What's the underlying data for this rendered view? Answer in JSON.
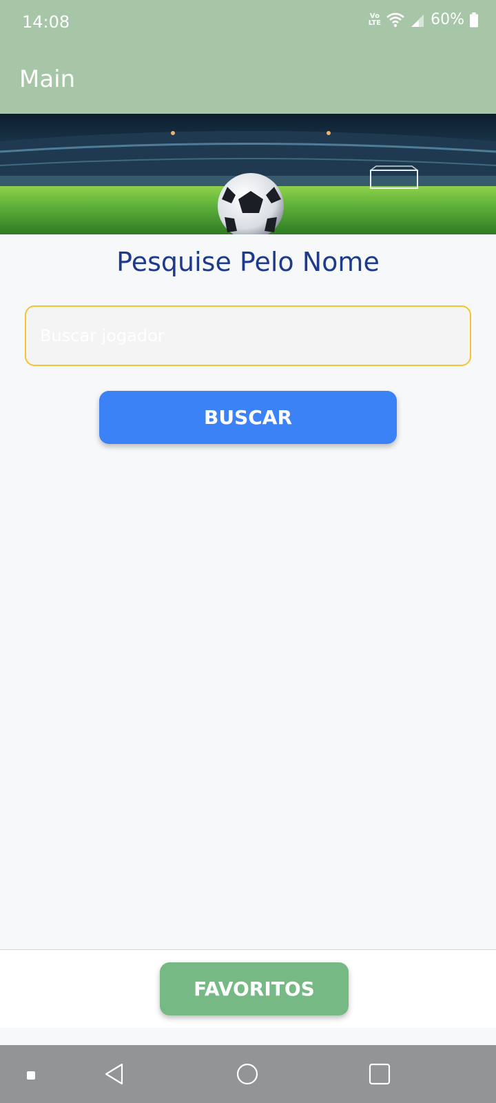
{
  "status_bar": {
    "time": "14:08",
    "volte_line1": "Vo",
    "volte_line2": "LTE",
    "battery": "60%",
    "icons": [
      "volte-icon",
      "wifi-icon",
      "signal-icon",
      "battery-icon"
    ]
  },
  "app_bar": {
    "title": "Main"
  },
  "banner": {
    "image": "soccer-stadium-ball-image"
  },
  "search": {
    "heading": "Pesquise Pelo Nome",
    "placeholder": "Buscar jogador",
    "value": "",
    "button_label": "BUSCAR"
  },
  "bottom": {
    "favorites_label": "FAVORITOS"
  },
  "nav_bar": {
    "icons": [
      "menu-dot-icon",
      "back-icon",
      "home-icon",
      "recents-icon"
    ]
  },
  "colors": {
    "app_bar": "#a6c6a7",
    "heading": "#1e3a8a",
    "input_border": "#f4c430",
    "buscar_button": "#3b82f6",
    "favoritos_button": "#77b984",
    "nav_bar": "#939495"
  }
}
